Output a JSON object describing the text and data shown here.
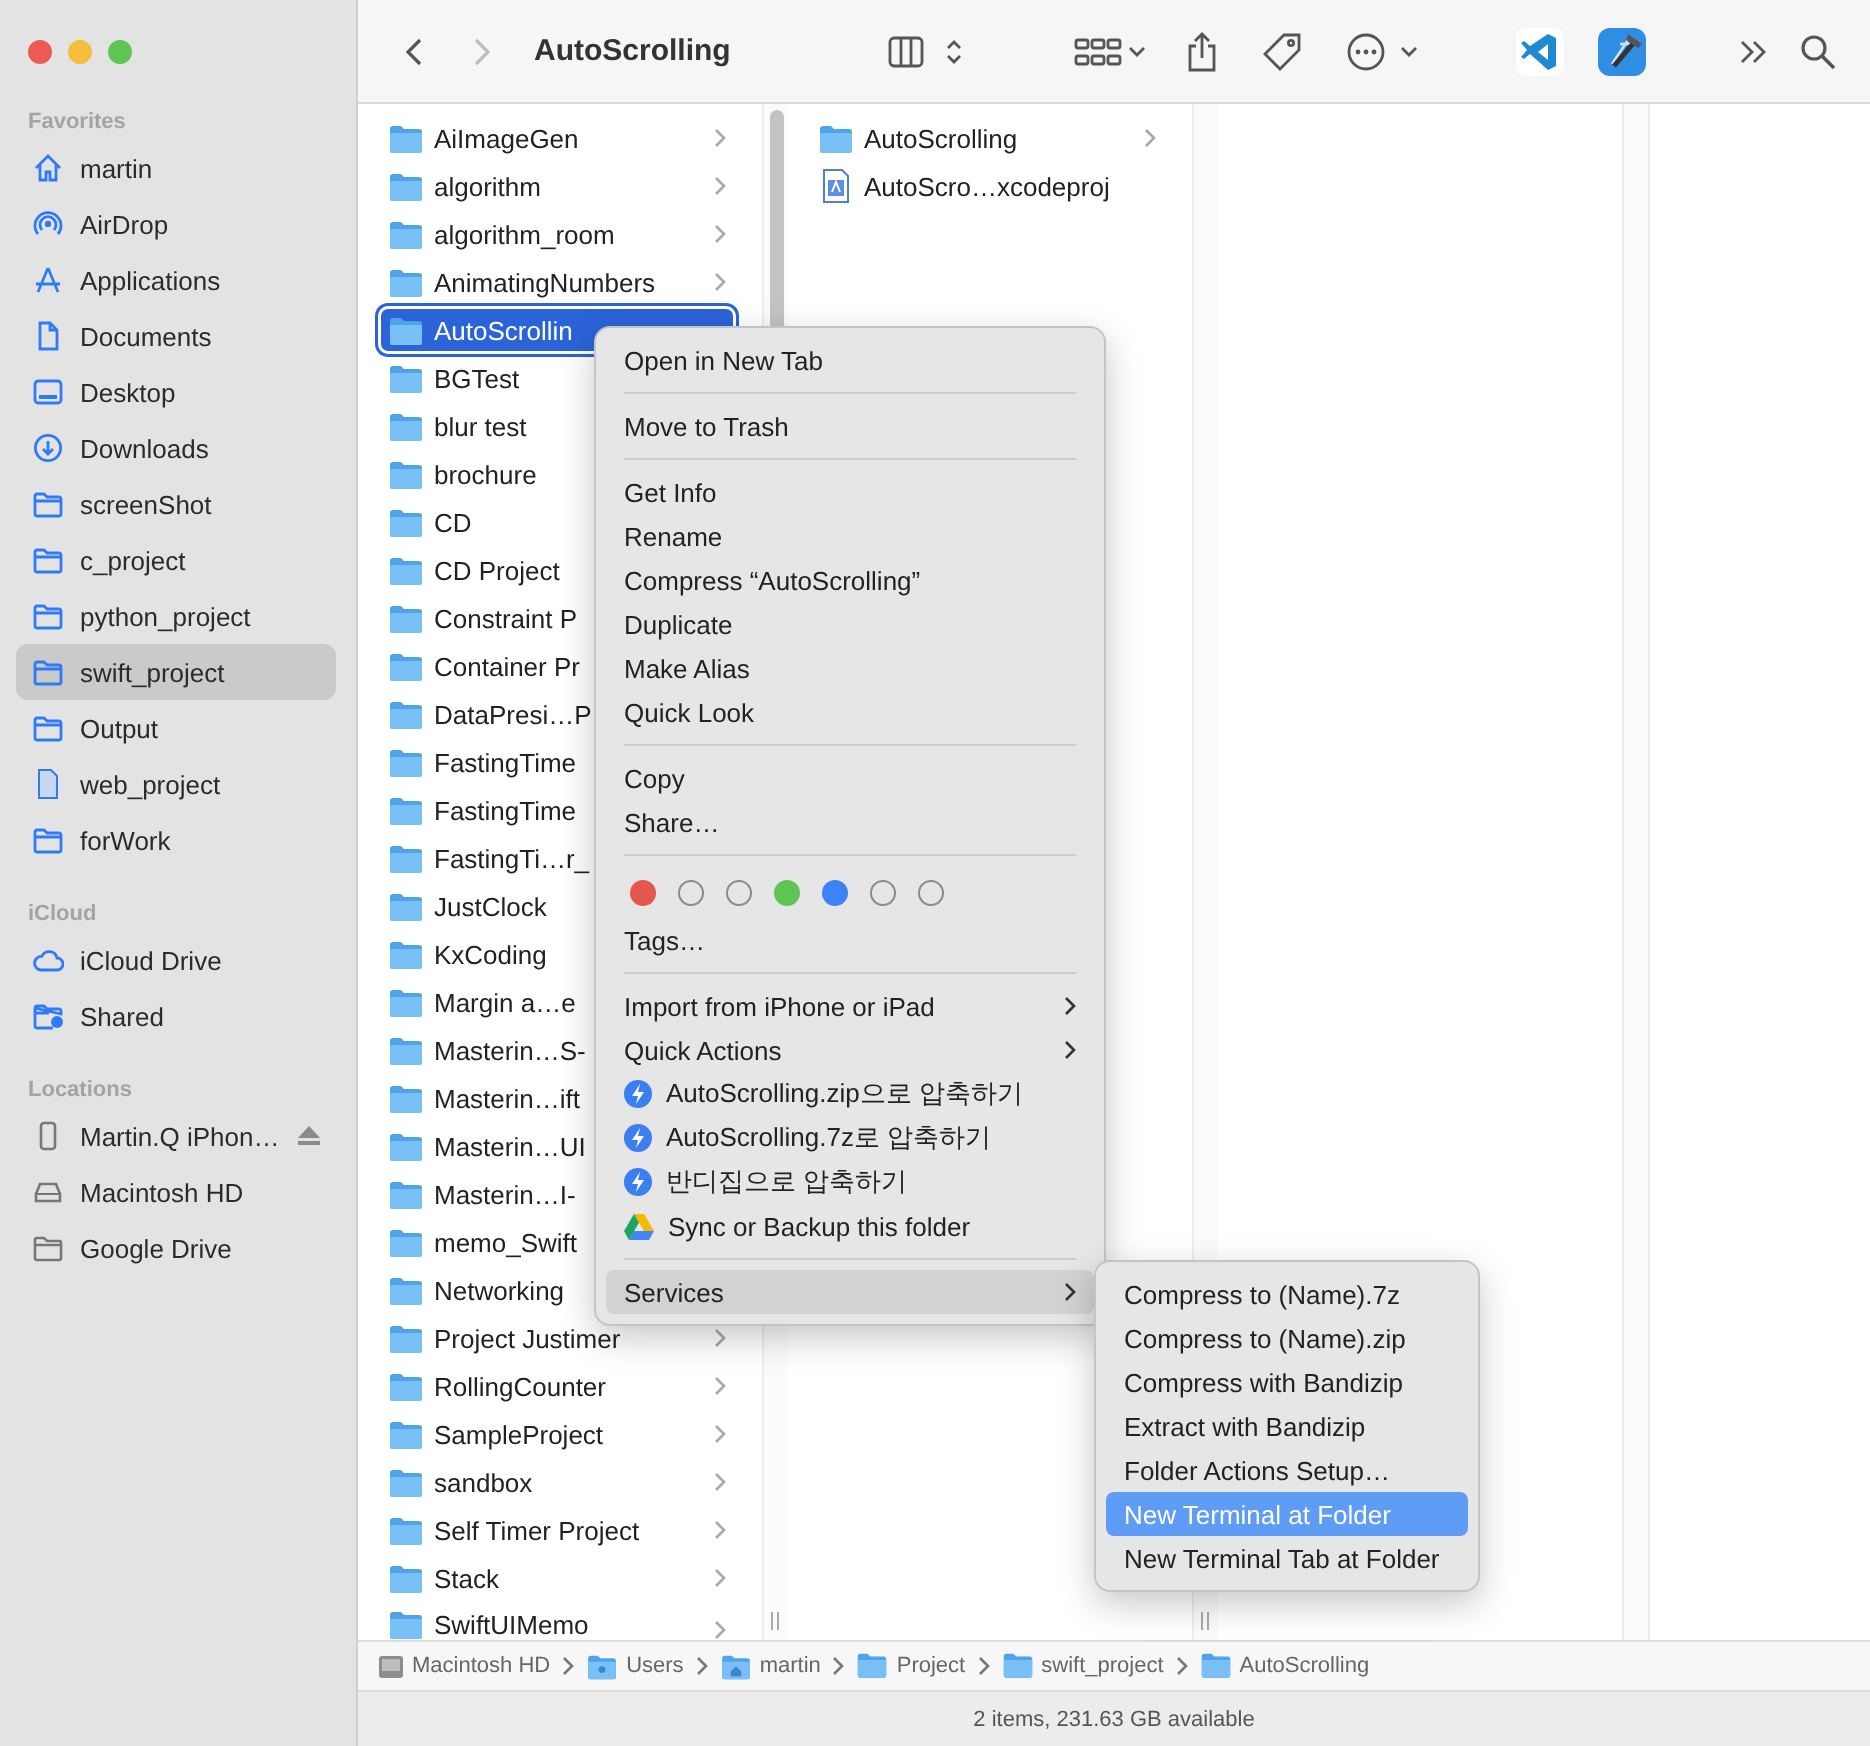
{
  "window": {
    "title": "AutoScrolling"
  },
  "toolbar": {
    "nav": [
      {
        "kind": "back",
        "disabled": false
      },
      {
        "kind": "forward",
        "disabled": true
      }
    ]
  },
  "sidebar": {
    "sections": [
      {
        "title": "Favorites",
        "items": [
          {
            "label": "martin",
            "kind": "home",
            "selected": false
          },
          {
            "label": "AirDrop",
            "kind": "airdrop",
            "selected": false
          },
          {
            "label": "Applications",
            "kind": "applications",
            "selected": false
          },
          {
            "label": "Documents",
            "kind": "documents",
            "selected": false
          },
          {
            "label": "Desktop",
            "kind": "desktop",
            "selected": false
          },
          {
            "label": "Downloads",
            "kind": "downloads",
            "selected": false
          },
          {
            "label": "screenShot",
            "kind": "folder",
            "selected": false
          },
          {
            "label": "c_project",
            "kind": "folder",
            "selected": false
          },
          {
            "label": "python_project",
            "kind": "folder",
            "selected": false
          },
          {
            "label": "swift_project",
            "kind": "folder",
            "selected": true
          },
          {
            "label": "Output",
            "kind": "folder",
            "selected": false
          },
          {
            "label": "web_project",
            "kind": "file",
            "selected": false
          },
          {
            "label": "forWork",
            "kind": "folder",
            "selected": false
          }
        ]
      },
      {
        "title": "iCloud",
        "items": [
          {
            "label": "iCloud Drive",
            "kind": "cloud",
            "selected": false
          },
          {
            "label": "Shared",
            "kind": "shared",
            "selected": false
          }
        ]
      },
      {
        "title": "Locations",
        "items": [
          {
            "label": "Martin.Q iPhon…",
            "kind": "phone",
            "selected": false,
            "ejectable": true
          },
          {
            "label": "Macintosh HD",
            "kind": "disk",
            "selected": false,
            "ejectable": false
          },
          {
            "label": "Google Drive",
            "kind": "drive",
            "selected": false,
            "ejectable": false
          }
        ]
      }
    ]
  },
  "columns": [
    {
      "items": [
        {
          "label": "AiImageGen",
          "kind": "folder",
          "selected": false,
          "expandable": true
        },
        {
          "label": "algorithm",
          "kind": "folder",
          "selected": false,
          "expandable": true
        },
        {
          "label": "algorithm_room",
          "kind": "folder",
          "selected": false,
          "expandable": true
        },
        {
          "label": "AnimatingNumbers",
          "kind": "folder",
          "selected": false,
          "expandable": true
        },
        {
          "label": "AutoScrollin",
          "kind": "folder",
          "selected": true,
          "expandable": false
        },
        {
          "label": "BGTest",
          "kind": "folder",
          "selected": false,
          "expandable": false
        },
        {
          "label": "blur test",
          "kind": "folder",
          "selected": false,
          "expandable": false
        },
        {
          "label": "brochure",
          "kind": "folder",
          "selected": false,
          "expandable": false
        },
        {
          "label": "CD",
          "kind": "folder",
          "selected": false,
          "expandable": false
        },
        {
          "label": "CD Project",
          "kind": "folder",
          "selected": false,
          "expandable": false
        },
        {
          "label": "Constraint P",
          "kind": "folder",
          "selected": false,
          "expandable": false
        },
        {
          "label": "Container Pr",
          "kind": "folder",
          "selected": false,
          "expandable": false
        },
        {
          "label": "DataPresi…P",
          "kind": "folder",
          "selected": false,
          "expandable": false
        },
        {
          "label": "FastingTime",
          "kind": "folder",
          "selected": false,
          "expandable": false
        },
        {
          "label": "FastingTime",
          "kind": "folder",
          "selected": false,
          "expandable": false
        },
        {
          "label": "FastingTi…r_",
          "kind": "folder",
          "selected": false,
          "expandable": false
        },
        {
          "label": "JustClock",
          "kind": "folder",
          "selected": false,
          "expandable": false
        },
        {
          "label": "KxCoding",
          "kind": "folder",
          "selected": false,
          "expandable": false
        },
        {
          "label": "Margin a…e",
          "kind": "folder",
          "selected": false,
          "expandable": false
        },
        {
          "label": "Masterin…S-",
          "kind": "folder",
          "selected": false,
          "expandable": false
        },
        {
          "label": "Masterin…ift",
          "kind": "folder",
          "selected": false,
          "expandable": false
        },
        {
          "label": "Masterin…UI",
          "kind": "folder",
          "selected": false,
          "expandable": false
        },
        {
          "label": "Masterin…I-",
          "kind": "folder",
          "selected": false,
          "expandable": false
        },
        {
          "label": "memo_Swift",
          "kind": "folder",
          "selected": false,
          "expandable": false
        },
        {
          "label": "Networking",
          "kind": "folder",
          "selected": false,
          "expandable": false
        },
        {
          "label": "Project Justimer",
          "kind": "folder",
          "selected": false,
          "expandable": true
        },
        {
          "label": "RollingCounter",
          "kind": "folder",
          "selected": false,
          "expandable": true
        },
        {
          "label": "SampleProject",
          "kind": "folder",
          "selected": false,
          "expandable": true
        },
        {
          "label": "sandbox",
          "kind": "folder",
          "selected": false,
          "expandable": true
        },
        {
          "label": "Self Timer Project",
          "kind": "folder",
          "selected": false,
          "expandable": true
        },
        {
          "label": "Stack",
          "kind": "folder",
          "selected": false,
          "expandable": true
        },
        {
          "label": "SwiftUIMemo",
          "kind": "folder",
          "selected": false,
          "expandable": true
        }
      ]
    },
    {
      "items": [
        {
          "label": "AutoScrolling",
          "kind": "folder",
          "selected": false,
          "expandable": true
        },
        {
          "label": "AutoScro…xcodeproj",
          "kind": "project",
          "selected": false,
          "expandable": false
        }
      ]
    }
  ],
  "context_menu": {
    "sections": [
      {
        "items": [
          {
            "label": "Open in New Tab",
            "kind": "item",
            "highlighted": false
          }
        ]
      },
      {
        "items": [
          {
            "label": "Move to Trash",
            "kind": "item",
            "highlighted": false
          }
        ]
      },
      {
        "items": [
          {
            "label": "Get Info",
            "kind": "item",
            "highlighted": false
          },
          {
            "label": "Rename",
            "kind": "item",
            "highlighted": false
          },
          {
            "label": "Compress “AutoScrolling”",
            "kind": "item",
            "highlighted": false
          },
          {
            "label": "Duplicate",
            "kind": "item",
            "highlighted": false
          },
          {
            "label": "Make Alias",
            "kind": "item",
            "highlighted": false
          },
          {
            "label": "Quick Look",
            "kind": "item",
            "highlighted": false
          }
        ]
      },
      {
        "items": [
          {
            "label": "Copy",
            "kind": "item",
            "highlighted": false
          },
          {
            "label": "Share…",
            "kind": "item",
            "highlighted": false
          }
        ]
      },
      {
        "tags": [
          {
            "kind": "filled",
            "color": "#e5564d"
          },
          {
            "kind": "empty"
          },
          {
            "kind": "empty"
          },
          {
            "kind": "filled",
            "color": "#5fc454"
          },
          {
            "kind": "filled",
            "color": "#3d82f6"
          },
          {
            "kind": "empty"
          },
          {
            "kind": "empty"
          }
        ],
        "items": [
          {
            "label": "Tags…",
            "kind": "item",
            "highlighted": false
          }
        ]
      },
      {
        "items": [
          {
            "label": "Import from iPhone or iPad",
            "kind": "submenu",
            "highlighted": false
          },
          {
            "label": "Quick Actions",
            "kind": "submenu",
            "highlighted": false
          },
          {
            "label": "AutoScrolling.zip으로 압축하기",
            "kind": "quick-action",
            "highlighted": false
          },
          {
            "label": "AutoScrolling.7z로 압축하기",
            "kind": "quick-action",
            "highlighted": false
          },
          {
            "label": "반디집으로 압축하기",
            "kind": "quick-action",
            "highlighted": false
          },
          {
            "label": "Sync or Backup this folder",
            "kind": "drive-action",
            "highlighted": false
          }
        ]
      },
      {
        "items": [
          {
            "label": "Services",
            "kind": "submenu",
            "highlighted": true
          }
        ]
      }
    ]
  },
  "services_submenu": {
    "items": [
      {
        "label": "Compress to (Name).7z",
        "highlighted": false
      },
      {
        "label": "Compress to (Name).zip",
        "highlighted": false
      },
      {
        "label": "Compress with Bandizip",
        "highlighted": false
      },
      {
        "label": "Extract with Bandizip",
        "highlighted": false
      },
      {
        "label": "Folder Actions Setup…",
        "highlighted": false
      },
      {
        "label": "New Terminal at Folder",
        "highlighted": true
      },
      {
        "label": "New Terminal Tab at Folder",
        "highlighted": false
      }
    ]
  },
  "path_bar": [
    {
      "label": "Macintosh HD",
      "kind": "disk"
    },
    {
      "label": "Users",
      "kind": "users"
    },
    {
      "label": "martin",
      "kind": "home"
    },
    {
      "label": "Project",
      "kind": "folder"
    },
    {
      "label": "swift_project",
      "kind": "folder"
    },
    {
      "label": "AutoScrolling",
      "kind": "folder"
    }
  ],
  "status_bar": {
    "text": "2 items, 231.63 GB available"
  }
}
